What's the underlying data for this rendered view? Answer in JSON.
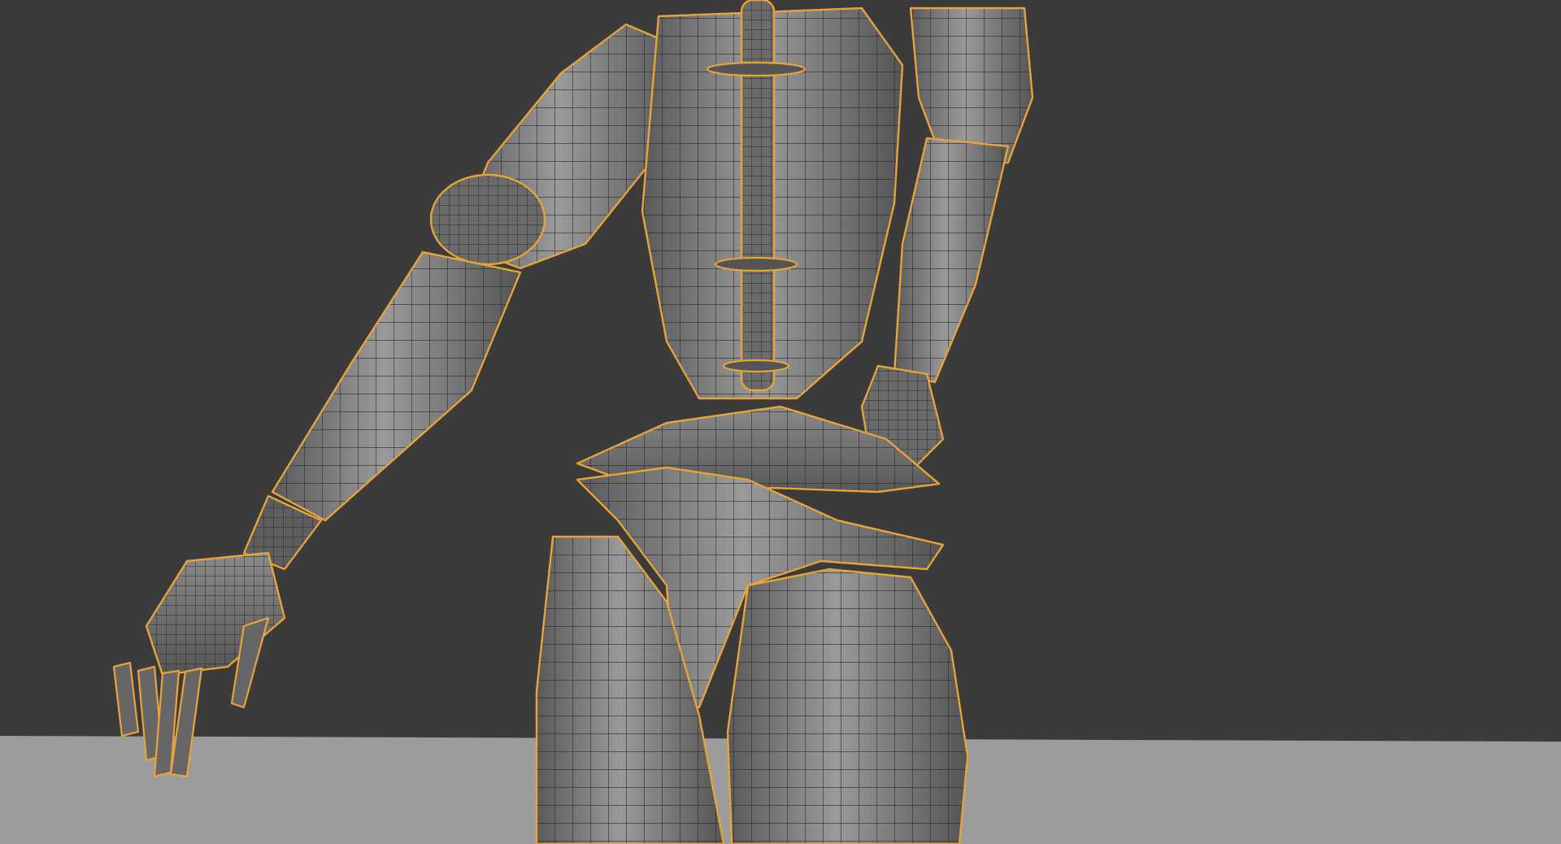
{
  "viewport": {
    "background_color": "#3b3b3b",
    "ground_color": "#9a9a9a",
    "mesh_fill_color": "#7a7a7a",
    "mesh_shadow_color": "#4a4a4a",
    "wire_color": "#2a2a2a",
    "selection_outline_color": "#e8a33a"
  },
  "scene": {
    "object": {
      "icon": "robot-mesh-icon",
      "selected": true,
      "display_mode": "wireframe-on-shaded"
    }
  }
}
